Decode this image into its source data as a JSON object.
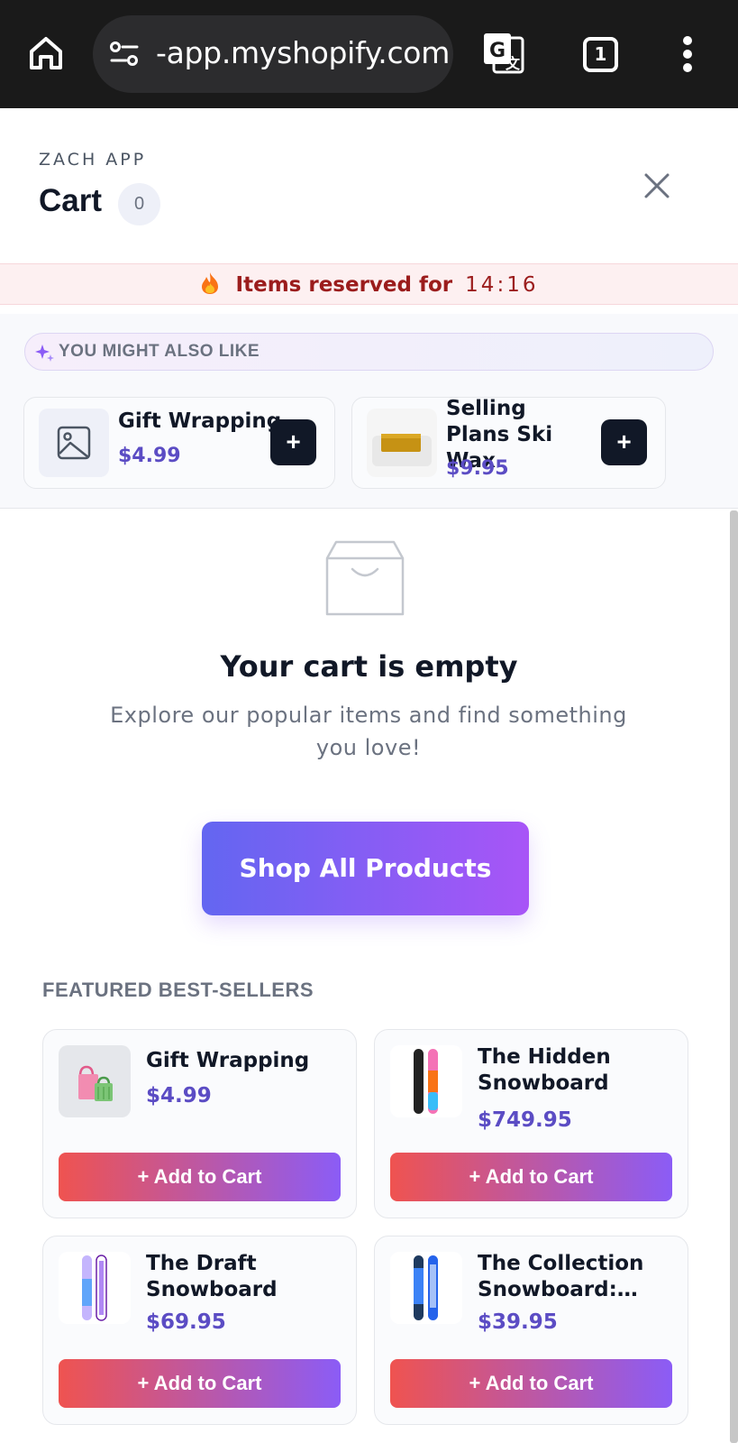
{
  "browser": {
    "url": "-app.myshopify.com",
    "tab_count": "1",
    "icons": [
      "home-icon",
      "site-settings-icon",
      "translate-icon",
      "tabs-icon",
      "more-vert-icon"
    ]
  },
  "cart": {
    "store_name": "ZACH APP",
    "title": "Cart",
    "count": "0"
  },
  "reservation": {
    "label": "Items reserved for",
    "timer": "14:16"
  },
  "upsell": {
    "heading": "YOU MIGHT ALSO LIKE",
    "items": [
      {
        "title": "Gift Wrapping",
        "price": "$4.99",
        "add_label": "+"
      },
      {
        "title": "Selling Plans Ski Wax",
        "price": "$9.95",
        "add_label": "+"
      }
    ]
  },
  "empty_state": {
    "title": "Your cart is empty",
    "subtitle": "Explore our popular items and find something you love!",
    "cta": "Shop All Products"
  },
  "featured": {
    "heading": "FEATURED BEST-SELLERS",
    "products": [
      {
        "title_line1": "Gift Wrapping",
        "title_line2": "",
        "price": "$4.99",
        "add_label": "+ Add to Cart"
      },
      {
        "title_line1": "The Hidden",
        "title_line2": "Snowboard",
        "price": "$749.95",
        "add_label": "+ Add to Cart"
      },
      {
        "title_line1": "The Draft",
        "title_line2": "Snowboard",
        "price": "$69.95",
        "add_label": "+ Add to Cart"
      },
      {
        "title_line1": "The Collection",
        "title_line2": "Snowboard:…",
        "price": "$39.95",
        "add_label": "+ Add to Cart"
      }
    ]
  },
  "colors": {
    "accent_price": "#5b4cc4",
    "cta_gradient_start": "#6366f1",
    "cta_gradient_end": "#a855f7",
    "add_gradient_start": "#ef5350",
    "add_gradient_end": "#8b5cf6",
    "reserve_text": "#9b1c1c"
  }
}
